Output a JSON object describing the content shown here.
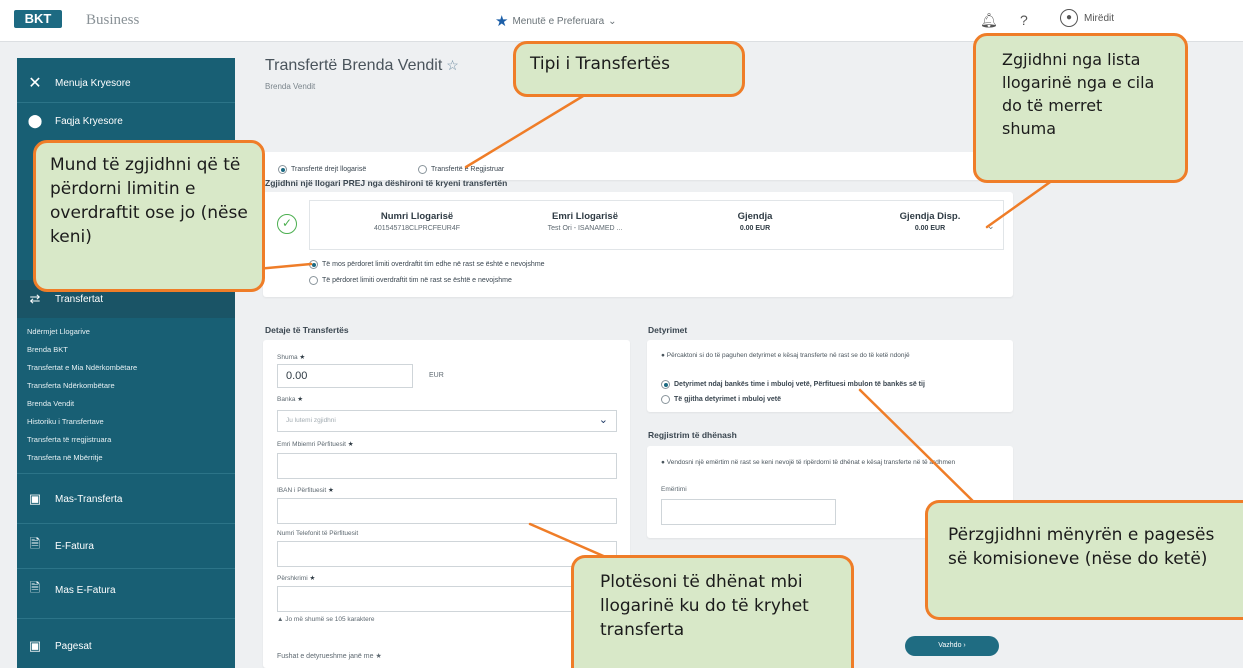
{
  "topbar": {
    "logo": "BKT",
    "brand": "Business",
    "favorites": "Menutë e Preferuara",
    "greeting": "Mirëdit"
  },
  "sidebar": {
    "main_menu": "Menuja Kryesore",
    "home": "Faqja Kryesore",
    "transfers": "Transfertat",
    "sub_items": [
      "Ndërmjet Llogarive",
      "Brenda BKT",
      "Transfertat e Mia Ndërkombëtare",
      "Transferta Ndërkombëtare",
      "Brenda Vendit",
      "Historiku i Transfertave",
      "Transferta të rregjistruara",
      "Transferta në Mbërritje"
    ],
    "mass_transfer": "Mas-Transferta",
    "einvoice": "E-Fatura",
    "mass_einvoice": "Mas E-Fatura",
    "payments": "Pagesat"
  },
  "page": {
    "title": "Transfertë Brenda Vendit",
    "subtitle": "Brenda Vendit"
  },
  "transfer_type": {
    "option1": "Transfertë drejt llogarisë",
    "option2": "Transfertë e Regjistruar"
  },
  "account": {
    "section_title": "Zgjidhni një llogari PREJ nga dëshironi të kryeni transfertën",
    "col1_head": "Numri Llogarisë",
    "col1_val": "401545718CLPRCFEUR4F",
    "col2_head": "Emri Llogarisë",
    "col2_val": "Test Ori - ISANAMED ...",
    "col3_head": "Gjendja",
    "col3_val": "0.00 EUR",
    "col4_head": "Gjendja Disp.",
    "col4_val": "0.00 EUR",
    "overdraft_no": "Të mos përdoret limiti overdraftit tim edhe në rast se është e nevojshme",
    "overdraft_yes": "Të përdoret limiti overdraftit tim në rast se është e nevojshme"
  },
  "details": {
    "title": "Detaje të Transfertës",
    "amount_label": "Shuma",
    "amount_value": "0.00",
    "currency": "EUR",
    "bank_label": "Banka",
    "bank_placeholder": "Ju lutemi zgjidhni",
    "beneficiary_label": "Emri Mbiemri Përfituesit",
    "iban_label": "IBAN i Përfituesit",
    "phone_label": "Numri Telefonit të Përfituesit",
    "desc_label": "Përshkrimi",
    "desc_hint": "Jo më shumë se 105 karaktere",
    "required_note": "Fushat e detyrueshme janë me",
    "continue": "Vazhdo"
  },
  "obligations": {
    "title": "Detyrimet",
    "info": "Përcaktoni si do të paguhen detyrimet e kësaj transferte në rast se do të ketë ndonjë",
    "opt1": "Detyrimet ndaj bankës time i mbuloj vetë, Përfituesi mbulon të bankës së tij",
    "opt2": "Të gjitha detyrimet i mbuloj vetë"
  },
  "registration": {
    "title": "Regjistrim të dhënash",
    "info": "Vendosni një emërtim në rast se keni nevojë të ripërdorni të dhënat e kësaj transferte në të ardhmen",
    "name_label": "Emërtimi"
  },
  "callouts": {
    "transfer_type": "Tipi i Transfertës",
    "choose_account": "Zgjidhni nga lista llogarinë nga e cila do të merret shuma",
    "overdraft": "Mund të zgjidhni që të përdorni limitin e overdraftit ose jo (nëse keni)",
    "fill_data": "Plotësoni të dhënat mbi llogarinë ku do të kryhet transferta",
    "commission": "Përzgjidhni mënyrën e pagesës së komisioneve (nëse do ketë)"
  },
  "colors": {
    "sidebar": "#185f74",
    "callout_border": "#ef7d28",
    "callout_fill": "#d8e8c8"
  }
}
